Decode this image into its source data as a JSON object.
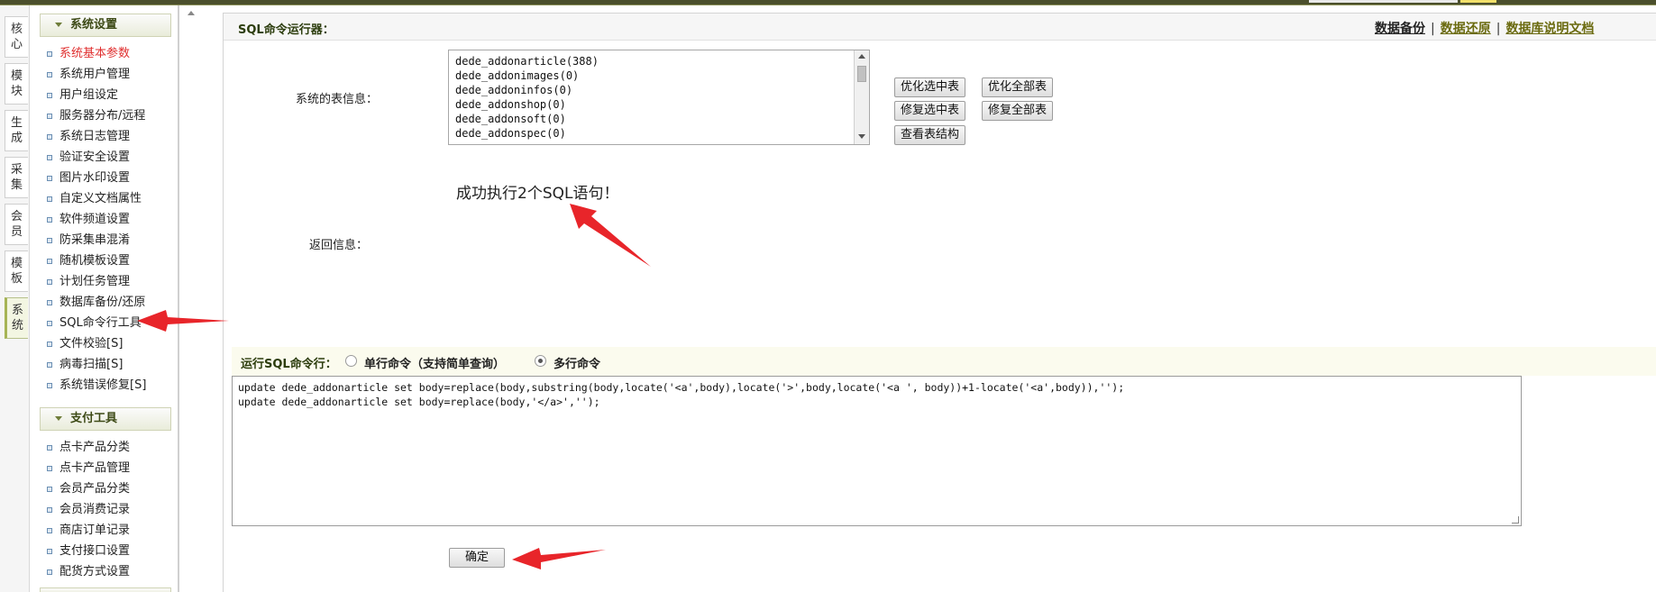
{
  "vtabs": [
    {
      "label": "核心"
    },
    {
      "label": "模块"
    },
    {
      "label": "生成"
    },
    {
      "label": "采集"
    },
    {
      "label": "会员"
    },
    {
      "label": "模板"
    },
    {
      "label": "系统"
    }
  ],
  "sidebar": {
    "section1": {
      "title": "系统设置",
      "items": [
        "系统基本参数",
        "系统用户管理",
        "用户组设定",
        "服务器分布/远程",
        "系统日志管理",
        "验证安全设置",
        "图片水印设置",
        "自定义文档属性",
        "软件频道设置",
        "防采集串混淆",
        "随机模板设置",
        "计划任务管理",
        "数据库备份/还原",
        "SQL命令行工具",
        "文件校验[S]",
        "病毒扫描[S]",
        "系统错误修复[S]"
      ]
    },
    "section2": {
      "title": "支付工具",
      "items": [
        "点卡产品分类",
        "点卡产品管理",
        "会员产品分类",
        "会员消费记录",
        "商店订单记录",
        "支付接口设置",
        "配货方式设置"
      ]
    }
  },
  "main": {
    "title": "SQL命令运行器：",
    "links": {
      "backup": "数据备份",
      "restore": "数据还原",
      "docs": "数据库说明文档",
      "separator": "|"
    },
    "table_info_label": "系统的表信息：",
    "tables": [
      "dede_addonarticle(388)",
      "dede_addonimages(0)",
      "dede_addoninfos(0)",
      "dede_addonshop(0)",
      "dede_addonsoft(0)",
      "dede_addonspec(0)"
    ],
    "buttons": {
      "optimize_selected": "优化选中表",
      "optimize_all": "优化全部表",
      "repair_selected": "修复选中表",
      "repair_all": "修复全部表",
      "view_structure": "查看表结构",
      "confirm": "确定"
    },
    "result_label": "返回信息：",
    "result_text": "成功执行2个SQL语句！",
    "command": {
      "label": "运行SQL命令行：",
      "single": "单行命令（支持简单查询）",
      "multi": "多行命令",
      "selected": "multi",
      "lines": [
        "update dede_addonarticle set body=replace(body,substring(body,locate('<a',body),locate('>',body,locate('<a ', body))+1-locate('<a',body)),'');",
        "update dede_addonarticle set body=replace(body,'</a>','');"
      ]
    }
  },
  "colors": {
    "accent_red_arrow": "#e8252a",
    "current_menu": "#e03030",
    "link": "#6b6b10"
  }
}
